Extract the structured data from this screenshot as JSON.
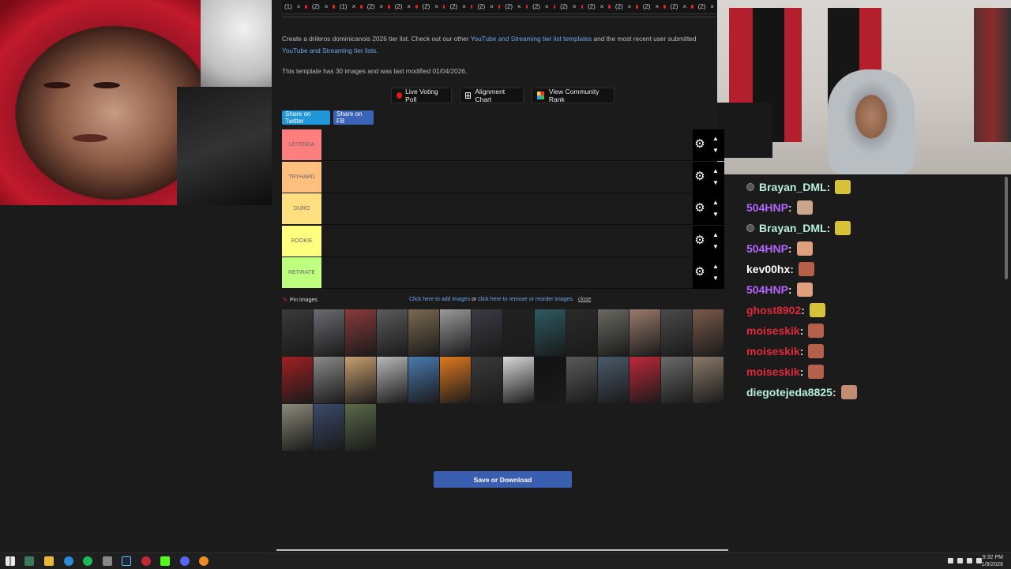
{
  "tabbar": {
    "items": [
      "(1)",
      "×",
      "(2)",
      "×",
      "(1)",
      "×",
      "(2)",
      "×",
      "(2)",
      "×",
      "(2)",
      "×",
      "(2)",
      "×",
      "(2)",
      "×",
      "(2)",
      "×",
      "(2)",
      "×",
      "(2)",
      "×",
      "(2)",
      "×",
      "(2)",
      "×",
      "(2)",
      "×",
      "(2)",
      "×",
      "(2)",
      "×"
    ]
  },
  "description": {
    "part1": "Create a drileros dominicanois 2026 tier list. Check out our other ",
    "link1": "YouTube and Streaming tier list templates",
    "part2": " and the most recent user submitted ",
    "link2": "YouTube and Streaming tier lists",
    "part3": ".",
    "info": "This template has 30 images and was last modified 01/04/2026."
  },
  "buttons": {
    "live_poll": "Live Voting Poll",
    "alignment": "Alignment Chart",
    "community": "View Community Rank",
    "twitter": "Share on Twitter",
    "fb": "Share on FB",
    "save": "Save or Download"
  },
  "tiers": [
    {
      "label": "LEYENDA",
      "color": "#ff7f7f"
    },
    {
      "label": "TRYHARD",
      "color": "#ffbf7f"
    },
    {
      "label": "DURO",
      "color": "#ffdf7f"
    },
    {
      "label": "ROOKIE",
      "color": "#ffff7f"
    },
    {
      "label": "RETIRATE",
      "color": "#bfff7f"
    }
  ],
  "pool": {
    "pin_label": "Pin Images",
    "add_link": "Click here to add images",
    "or": " or ",
    "remove_link": "click here to remove or reorder images.",
    "close": "close"
  },
  "chat": [
    {
      "user": "Brayan_DML",
      "color": "#b7f0de",
      "badge": true,
      "emote_color": "#d8c23a"
    },
    {
      "user": "504HNP",
      "color": "#b467ff",
      "badge": false,
      "emote_color": "#caa68c"
    },
    {
      "user": "Brayan_DML",
      "color": "#b7f0de",
      "badge": true,
      "emote_color": "#d8c23a"
    },
    {
      "user": "504HNP",
      "color": "#b467ff",
      "badge": false,
      "emote_color": "#e0a080"
    },
    {
      "user": "kev00hx",
      "color": "#ffffff",
      "badge": false,
      "emote_color": "#b5604a"
    },
    {
      "user": "504HNP",
      "color": "#b467ff",
      "badge": false,
      "emote_color": "#e0a080"
    },
    {
      "user": "ghost8902",
      "color": "#e2283a",
      "badge": false,
      "emote_color": "#d8c23a"
    },
    {
      "user": "moiseskik",
      "color": "#e2283a",
      "badge": false,
      "emote_color": "#b5604a"
    },
    {
      "user": "moiseskik",
      "color": "#e2283a",
      "badge": false,
      "emote_color": "#b5604a"
    },
    {
      "user": "moiseskik",
      "color": "#e2283a",
      "badge": false,
      "emote_color": "#b5604a"
    },
    {
      "user": "diegotejeda8825",
      "color": "#b7f0de",
      "badge": false,
      "emote_color": "#c48c74"
    }
  ],
  "chat_separator": " :",
  "taskbar": {
    "time": "9:32 PM",
    "date": "1/9/2026"
  },
  "thumb_colors": [
    "#3a3a3a",
    "#6b6b73",
    "#8a3b3b",
    "#5b5b5b",
    "#7a6a50",
    "#9a9a9a",
    "#3d3a44",
    "#222",
    "#2d5b61",
    "#2b2b2b",
    "#6a6a62",
    "#9a7b6b",
    "#4a4a4a",
    "#7a5a4a",
    "#a02020",
    "#8a8a8a",
    "#c8a070",
    "#b9b9b9",
    "#4a7ab0",
    "#e07a20",
    "#3a3a3a",
    "#d9d9d9",
    "#111",
    "#5a5a5a",
    "#4a5a6a",
    "#c0283a",
    "#6a6a6a",
    "#8a7a6a",
    "#8a8a7a",
    "#3a4a6a",
    "#5a6a4a"
  ]
}
